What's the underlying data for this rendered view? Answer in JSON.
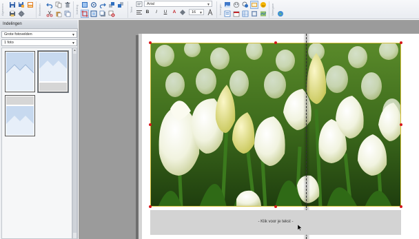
{
  "toolbar": {
    "groups": [
      "Algemeen",
      "Bewerken",
      "Indeling",
      "Tekst",
      "Invoegen",
      "Weergave"
    ],
    "font_value": "Arial",
    "size_value": "16",
    "bold_label": "B",
    "italic_label": "I",
    "underline_label": "U",
    "font_color_label": "A"
  },
  "panel": {
    "title": "Indelingen",
    "category_value": "Grote fotovelden",
    "count_value": "1 foto"
  },
  "page": {
    "caption_text": "- Klik voor je tekst -"
  },
  "colors": {
    "toolbar_bg": "#eef0f4",
    "canvas_bg": "#9b9b9b",
    "handle": "#d8161b",
    "photo_border": "#d5bf3a",
    "caption_bg": "#d3d3d3"
  }
}
